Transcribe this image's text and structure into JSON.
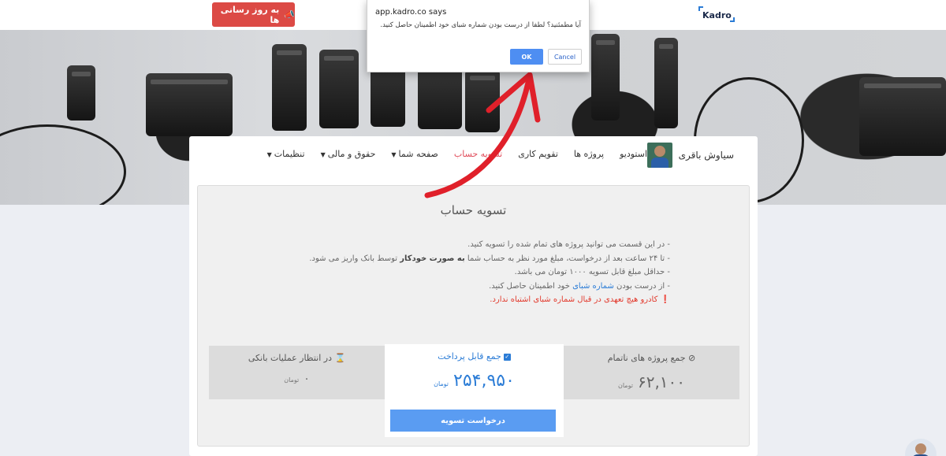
{
  "topbar": {
    "update_button": "به روز رسانی ها",
    "logo_text": "Kadro",
    "accent_color": "#dc4a45"
  },
  "profile": {
    "name": "سیاوش باقری"
  },
  "nav": {
    "studio": "استودیو",
    "projects": "پروژه ها",
    "calendar": "تقویم کاری",
    "settlement": "تسویه حساب",
    "your_page": "صفحه شما",
    "payroll": "حقوق و مالی",
    "settings": "تنظیمات"
  },
  "page": {
    "title": "تسویه حساب",
    "notes": {
      "line1": "- در این قسمت می توانید پروژه های تمام شده را تسویه کنید.",
      "line2_a": "- تا ۲۴ ساعت بعد از درخواست، مبلغ مورد نظر به حساب شما ",
      "line2_b": "به صورت خودکار",
      "line2_c": " توسط بانک واریز می شود.",
      "line3": "- حداقل مبلغ قابل تسویه ۱۰۰۰ تومان می باشد.",
      "line4_a": "- از درست بودن ",
      "line4_b": "شماره شبای",
      "line4_c": " خود اطمینان حاصل کنید.",
      "warning": "کادرو هیچ تعهدی در قبال شماره شبای اشتباه ندارد."
    }
  },
  "stats": {
    "pending": {
      "title": "در انتظار عملیات بانکی",
      "value": "۰",
      "unit": "تومان"
    },
    "payable": {
      "title": "جمع قابل پرداخت",
      "value": "۲۵۴,۹۵۰",
      "unit": "تومان"
    },
    "unfinished": {
      "title": "جمع پروژه های ناتمام",
      "value": "۶۲,۱۰۰",
      "unit": "تومان"
    },
    "settle_button": "درخواست تسویه",
    "accent_color": "#2b7cd6"
  },
  "dialog": {
    "title": "app.kadro.co says",
    "message": "آیا مطمئنید؟ لطفا از درست بودن شماره شبای خود اطمینان حاصل کنید.",
    "ok": "OK",
    "cancel": "Cancel"
  },
  "icons": {
    "megaphone": "megaphone-icon",
    "hourglass": "hourglass-icon",
    "checkbox": "checkbox-icon",
    "ban": "ban-icon",
    "exclamation": "exclamation-circle-icon",
    "caret": "caret-down-icon"
  }
}
